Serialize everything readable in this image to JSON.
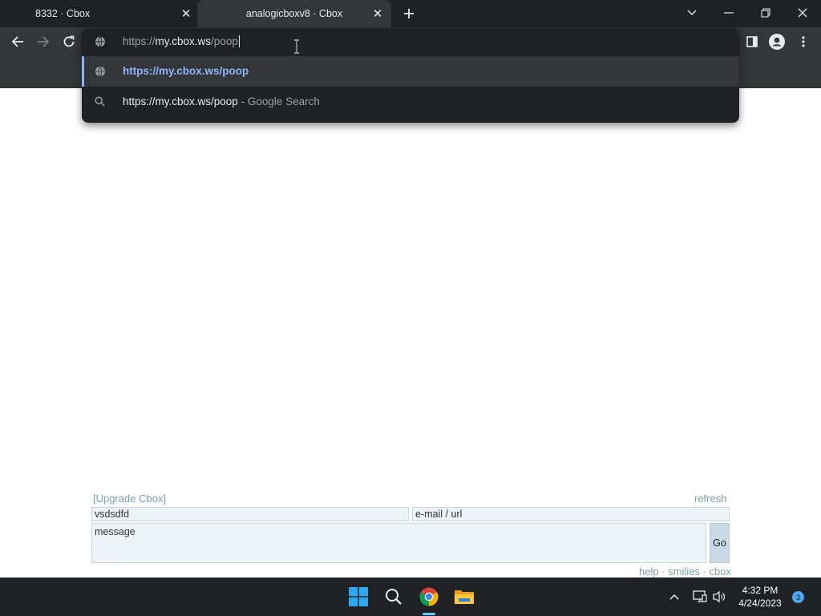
{
  "browser": {
    "tabs": [
      {
        "title": "8332 · Cbox",
        "active": false
      },
      {
        "title": "analogicboxv8 · Cbox",
        "active": true
      }
    ],
    "omnibox": {
      "typed_scheme": "https://",
      "typed_host": "my.cbox.ws",
      "typed_path": "/poop",
      "suggestions": [
        {
          "text": "https://my.cbox.ws/poop",
          "suffix": "",
          "icon": "globe-icon",
          "selected": true
        },
        {
          "text": "https://my.cbox.ws/poop",
          "suffix": "- Google Search",
          "icon": "search-icon",
          "selected": false
        }
      ]
    }
  },
  "cbox": {
    "upgrade_link": "[Upgrade Cbox]",
    "refresh_link": "refresh",
    "name_value": "vsdsdfd",
    "email_placeholder": "e-mail / url",
    "message_placeholder": "message",
    "go_label": "Go",
    "footer_links": [
      "help",
      "smilies",
      "cbox"
    ],
    "footer_separator": "·"
  },
  "taskbar": {
    "time": "4:32 PM",
    "date": "4/24/2023",
    "notification_count": "3"
  },
  "colors": {
    "accent_blue": "#8ab4f8",
    "dark_bg": "#202124",
    "toolbar_bg": "#35363a",
    "cbox_link": "#7a9fa5"
  }
}
